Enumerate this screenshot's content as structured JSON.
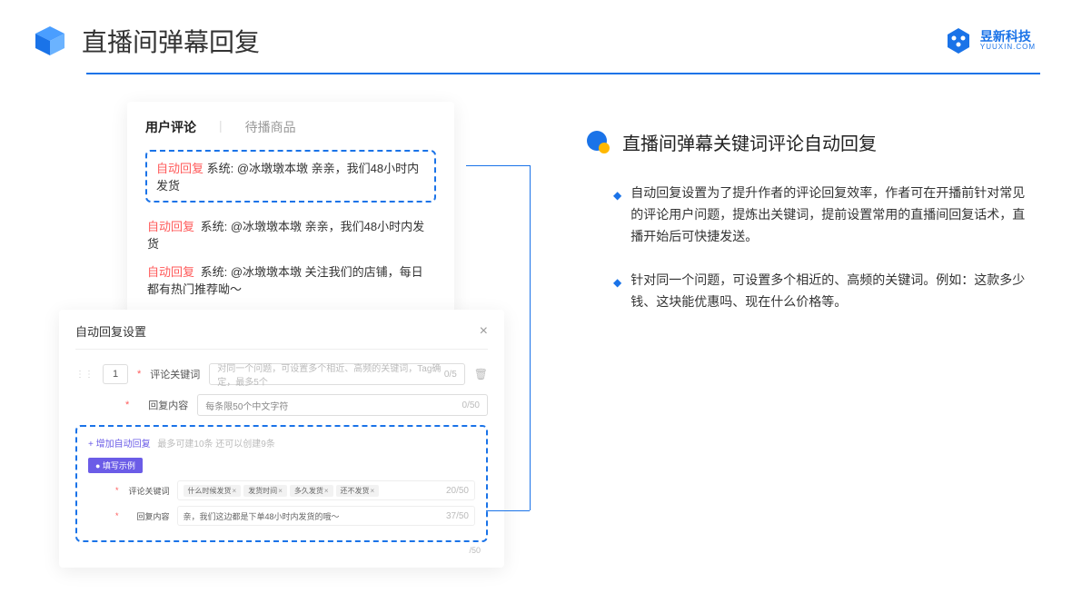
{
  "header": {
    "title": "直播间弹幕回复",
    "brand_name": "昱新科技",
    "brand_domain": "YUUXIN.COM"
  },
  "card1": {
    "tab_active": "用户评论",
    "tab_inactive": "待播商品",
    "highlighted": {
      "label": "自动回复",
      "text": "系统: @冰墩墩本墩 亲亲，我们48小时内发货"
    },
    "rows": [
      {
        "label": "自动回复",
        "text": "系统: @冰墩墩本墩 亲亲，我们48小时内发货"
      },
      {
        "label": "自动回复",
        "text": "系统: @冰墩墩本墩 关注我们的店铺，每日都有热门推荐呦～"
      }
    ]
  },
  "card2": {
    "title": "自动回复设置",
    "row_num": "1",
    "field1_label": "评论关键词",
    "field1_placeholder": "对同一个问题，可设置多个相近、高频的关键词，Tag确定，最多5个",
    "field1_counter": "0/5",
    "field2_label": "回复内容",
    "field2_placeholder": "每条限50个中文字符",
    "field2_counter": "0/50",
    "add_link": "+ 增加自动回复",
    "add_hint": "最多可建10条 还可以创建9条",
    "example_badge": "● 填写示例",
    "ex_field1_label": "评论关键词",
    "ex_tags": [
      "什么时候发货",
      "发货时间",
      "多久发货",
      "还不发货"
    ],
    "ex_field1_counter": "20/50",
    "ex_field2_label": "回复内容",
    "ex_field2_value": "亲，我们这边都是下单48小时内发货的哦～",
    "ex_field2_counter": "37/50",
    "outer_counter": "/50"
  },
  "right": {
    "section_title": "直播间弹幕关键词评论自动回复",
    "bullets": [
      "自动回复设置为了提升作者的评论回复效率，作者可在开播前针对常见的评论用户问题，提炼出关键词，提前设置常用的直播间回复话术，直播开始后可快捷发送。",
      "针对同一个问题，可设置多个相近的、高频的关键词。例如：这款多少钱、这块能优惠吗、现在什么价格等。"
    ]
  }
}
